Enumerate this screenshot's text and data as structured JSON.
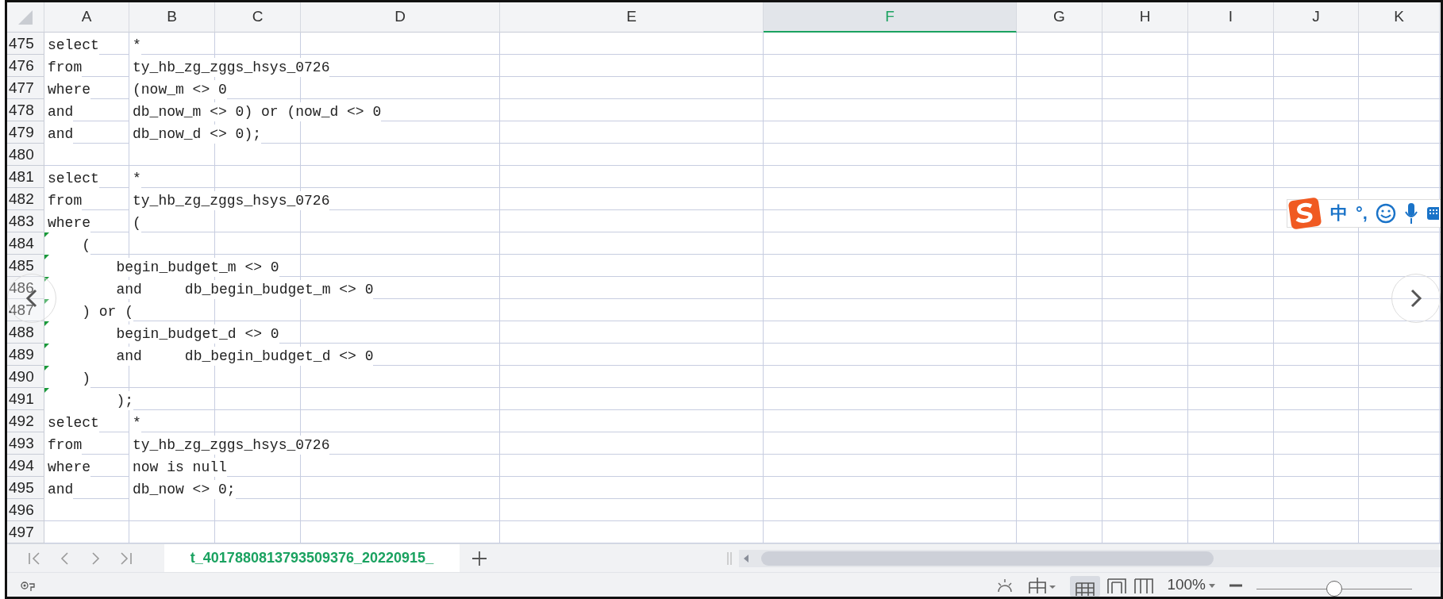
{
  "columns": [
    {
      "label": "A",
      "selected": false
    },
    {
      "label": "B",
      "selected": false
    },
    {
      "label": "C",
      "selected": false
    },
    {
      "label": "D",
      "selected": false
    },
    {
      "label": "E",
      "selected": false
    },
    {
      "label": "F",
      "selected": true
    },
    {
      "label": "G",
      "selected": false
    },
    {
      "label": "H",
      "selected": false
    },
    {
      "label": "I",
      "selected": false
    },
    {
      "label": "J",
      "selected": false
    },
    {
      "label": "K",
      "selected": false
    }
  ],
  "rows": [
    {
      "number": "475",
      "a": "select",
      "b": "*",
      "flag": false
    },
    {
      "number": "476",
      "a": "from",
      "b": "ty_hb_zg_zggs_hsys_0726",
      "flag": false
    },
    {
      "number": "477",
      "a": "where",
      "b": "(now_m <> 0",
      "flag": false
    },
    {
      "number": "478",
      "a": "and",
      "b": "db_now_m <> 0) or (now_d <> 0",
      "flag": false
    },
    {
      "number": "479",
      "a": "and",
      "b": "db_now_d <> 0);",
      "flag": false
    },
    {
      "number": "480",
      "flag": false
    },
    {
      "number": "481",
      "a": "select",
      "b": "*",
      "flag": false
    },
    {
      "number": "482",
      "a": "from",
      "b": "ty_hb_zg_zggs_hsys_0726",
      "flag": false
    },
    {
      "number": "483",
      "a": "where",
      "b": "(",
      "flag": false
    },
    {
      "number": "484",
      "a": "    (",
      "flag": true
    },
    {
      "number": "485",
      "a": "        begin_budget_m <> 0",
      "flag": true
    },
    {
      "number": "486",
      "a": "        and     db_begin_budget_m <> 0",
      "flag": true
    },
    {
      "number": "487",
      "a": "    ) or (",
      "flag": true
    },
    {
      "number": "488",
      "a": "        begin_budget_d <> 0",
      "flag": true
    },
    {
      "number": "489",
      "a": "        and     db_begin_budget_d <> 0",
      "flag": true
    },
    {
      "number": "490",
      "a": "    )",
      "flag": true
    },
    {
      "number": "491",
      "a": "        );",
      "flag": true
    },
    {
      "number": "492",
      "a": "select",
      "b": "*",
      "flag": false
    },
    {
      "number": "493",
      "a": "from",
      "b": "ty_hb_zg_zggs_hsys_0726",
      "flag": false
    },
    {
      "number": "494",
      "a": "where",
      "b": "now is null",
      "flag": false
    },
    {
      "number": "495",
      "a": "and",
      "b": "db_now <> 0;",
      "flag": false
    },
    {
      "number": "496",
      "flag": false
    },
    {
      "number": "497",
      "flag": false
    }
  ],
  "sheet_tabs": [
    {
      "label": "t_4017880813793509376_20220915_",
      "selected": true
    }
  ],
  "ime_toolbar": {
    "items": [
      "中",
      "°,"
    ]
  },
  "status_bar": {
    "zoom": "100%",
    "zoom_slider": {
      "level": 0.5
    }
  }
}
